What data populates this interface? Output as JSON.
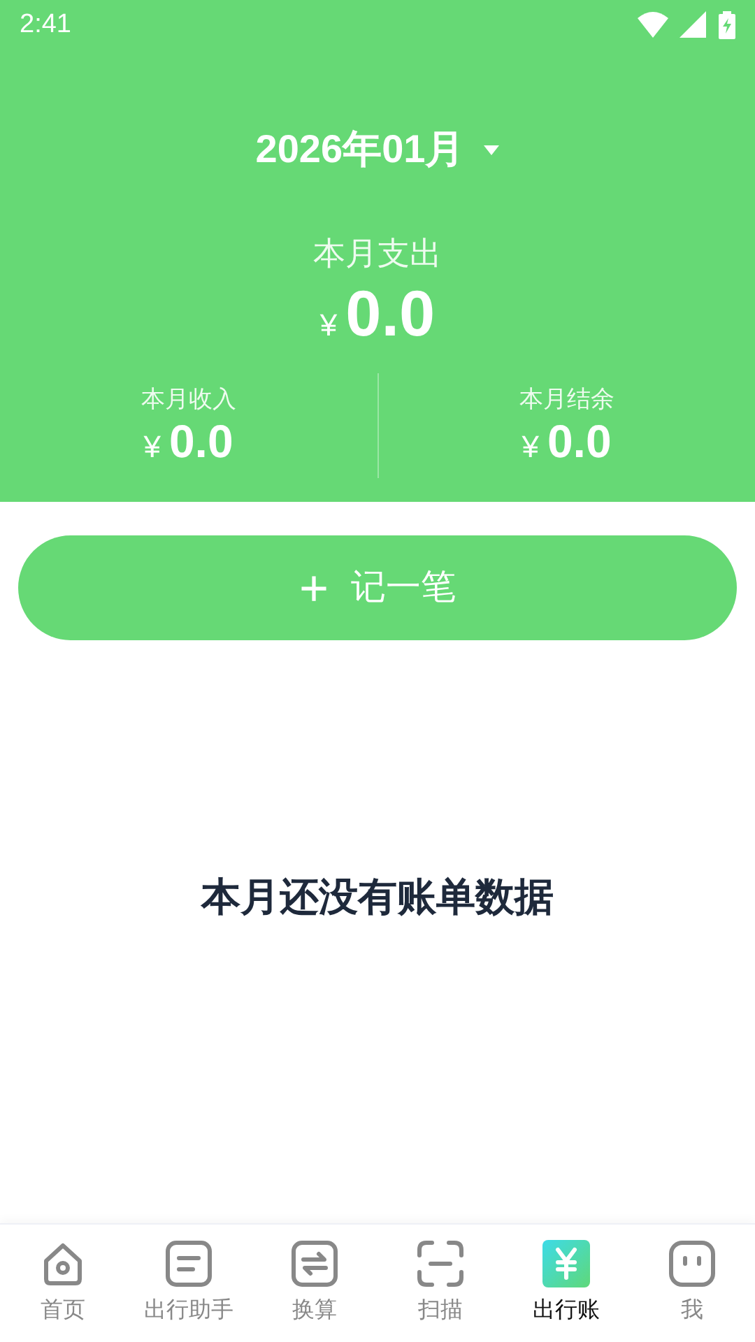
{
  "status_bar": {
    "time": "2:41"
  },
  "header": {
    "month": "2026年01月",
    "expense_label": "本月支出",
    "currency": "¥",
    "expense": "0.0",
    "stats": [
      {
        "label": "本月收入",
        "currency": "¥",
        "value": "0.0"
      },
      {
        "label": "本月结余",
        "currency": "¥",
        "value": "0.0"
      }
    ]
  },
  "add_button": {
    "icon": "+",
    "label": "记一笔"
  },
  "empty_message": "本月还没有账单数据",
  "bottom_nav": [
    {
      "label": "首页",
      "kind": "home",
      "selected": false
    },
    {
      "label": "出行助手",
      "kind": "notes",
      "selected": false
    },
    {
      "label": "换算",
      "kind": "swap",
      "selected": false
    },
    {
      "label": "扫描",
      "kind": "scan",
      "selected": false
    },
    {
      "label": "出行账",
      "kind": "yen",
      "selected": true
    },
    {
      "label": "我",
      "kind": "face",
      "selected": false
    }
  ]
}
